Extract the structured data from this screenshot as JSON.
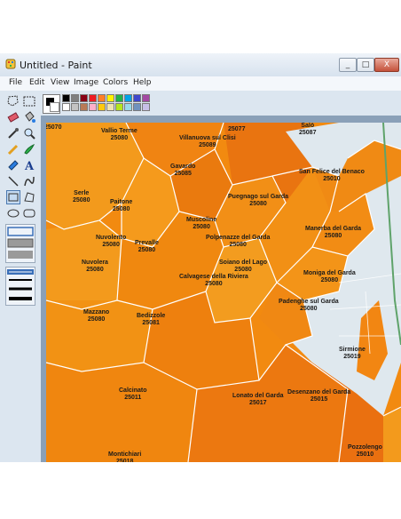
{
  "window": {
    "title": "Untitled - Paint"
  },
  "menu": [
    "File",
    "Edit",
    "View",
    "Image",
    "Colors",
    "Help"
  ],
  "window_buttons": {
    "minimize": "_",
    "maximize": "□",
    "close": "X"
  },
  "colors": {
    "map_orange": "#f0820a",
    "map_orange_dark": "#e46a0c",
    "map_orange_light": "#f59a1c",
    "lake": "#dfe8ee",
    "border_white": "#ffffff",
    "road_green": "#5fa36a"
  },
  "palette": [
    "#000000",
    "#7f7f7f",
    "#880015",
    "#ed1c24",
    "#ff7f27",
    "#fff200",
    "#22b14c",
    "#00a2e8",
    "#3f48cc",
    "#a349a4",
    "#ffffff",
    "#c3c3c3",
    "#b97a57",
    "#ffaec9",
    "#ffc90e",
    "#efe4b0",
    "#b5e61d",
    "#99d9ea",
    "#7092be",
    "#c8bfe7"
  ],
  "map_labels": [
    {
      "name": "",
      "code": "25070"
    },
    {
      "name": "Vallio Terme",
      "code": "25080"
    },
    {
      "name": "Villanuova sul Clisi",
      "code": "25089"
    },
    {
      "name": "",
      "code": "25077"
    },
    {
      "name": "Salò",
      "code": "25087"
    },
    {
      "name": "Gavardo",
      "code": "25085"
    },
    {
      "name": "San Felice del Benaco",
      "code": "25010"
    },
    {
      "name": "Serle",
      "code": "25080"
    },
    {
      "name": "Paitone",
      "code": "25080"
    },
    {
      "name": "Puegnago sul Garda",
      "code": "25080"
    },
    {
      "name": "Muscoline",
      "code": "25080"
    },
    {
      "name": "Manerba del Garda",
      "code": "25080"
    },
    {
      "name": "Nuvolento",
      "code": "25080"
    },
    {
      "name": "Prevalle",
      "code": "25080"
    },
    {
      "name": "Polpenazze del Garda",
      "code": "25080"
    },
    {
      "name": "Nuvolera",
      "code": "25080"
    },
    {
      "name": "Soiano del Lago",
      "code": "25080"
    },
    {
      "name": "Moniga del Garda",
      "code": "25080"
    },
    {
      "name": "Calvagese della Riviera",
      "code": "25080"
    },
    {
      "name": "Padenghe sul Garda",
      "code": "25080"
    },
    {
      "name": "Mazzano",
      "code": "25080"
    },
    {
      "name": "Bedizzole",
      "code": "25081"
    },
    {
      "name": "Sirmione",
      "code": "25019"
    },
    {
      "name": "Calcinato",
      "code": "25011"
    },
    {
      "name": "Lonato del Garda",
      "code": "25017"
    },
    {
      "name": "Desenzano del Garda",
      "code": "25015"
    },
    {
      "name": "Montichiari",
      "code": "25018"
    },
    {
      "name": "Pozzolengo",
      "code": "25010"
    }
  ]
}
